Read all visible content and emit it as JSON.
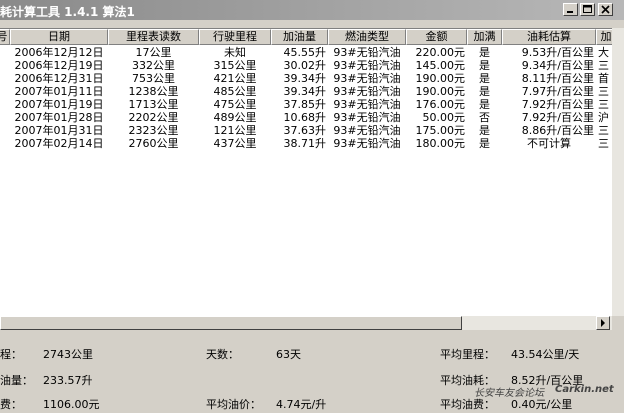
{
  "window": {
    "title": "耗计算工具 1.4.1 算法1"
  },
  "table": {
    "columns": [
      {
        "label": "号"
      },
      {
        "label": "日期"
      },
      {
        "label": "里程表读数"
      },
      {
        "label": "行驶里程"
      },
      {
        "label": "加油量"
      },
      {
        "label": "燃油类型"
      },
      {
        "label": "金额"
      },
      {
        "label": "加满"
      },
      {
        "label": "油耗估算"
      },
      {
        "label": "加"
      }
    ],
    "rows": [
      [
        "",
        "2006年12月12日",
        "17公里",
        "未知",
        "45.55升",
        "93#无铅汽油",
        "220.00元",
        "是",
        "9.53升/百公里",
        "大"
      ],
      [
        "",
        "2006年12月19日",
        "332公里",
        "315公里",
        "30.02升",
        "93#无铅汽油",
        "145.00元",
        "是",
        "9.34升/百公里",
        "三"
      ],
      [
        "",
        "2006年12月31日",
        "753公里",
        "421公里",
        "39.34升",
        "93#无铅汽油",
        "190.00元",
        "是",
        "8.11升/百公里",
        "首"
      ],
      [
        "",
        "2007年01月11日",
        "1238公里",
        "485公里",
        "39.34升",
        "93#无铅汽油",
        "190.00元",
        "是",
        "7.97升/百公里",
        "三"
      ],
      [
        "",
        "2007年01月19日",
        "1713公里",
        "475公里",
        "37.85升",
        "93#无铅汽油",
        "176.00元",
        "是",
        "7.92升/百公里",
        "三"
      ],
      [
        "",
        "2007年01月28日",
        "2202公里",
        "489公里",
        "10.68升",
        "93#无铅汽油",
        "50.00元",
        "否",
        "7.92升/百公里",
        "沪"
      ],
      [
        "",
        "2007年01月31日",
        "2323公里",
        "121公里",
        "37.63升",
        "93#无铅汽油",
        "175.00元",
        "是",
        "8.86升/百公里",
        "三"
      ],
      [
        "",
        "2007年02月14日",
        "2760公里",
        "437公里",
        "38.71升",
        "93#无铅汽油",
        "180.00元",
        "是",
        "不可计算",
        "三"
      ]
    ]
  },
  "summary": {
    "mileage_label": "程：",
    "mileage_value": "2743公里",
    "days_label": "天数：",
    "days_value": "63天",
    "avg_mileage_label": "平均里程：",
    "avg_mileage_value": "43.54公里/天",
    "fuel_label": "油量：",
    "fuel_value": "233.57升",
    "avg_consumption_label": "平均油耗：",
    "avg_consumption_value": "8.52升/百公里",
    "cost_label": "费：",
    "cost_value": "1106.00元",
    "avg_price_label": "平均油价：",
    "avg_price_value": "4.74元/升",
    "avg_cost_label": "平均油费：",
    "avg_cost_value": "0.40元/公里"
  },
  "watermark": {
    "line1": "长安车友会论坛",
    "line2": "Carkin.net"
  },
  "colors": {
    "face": "#d4d0c8",
    "grid_bg": "#ffffff",
    "title_bar": "#9a9a9a"
  }
}
